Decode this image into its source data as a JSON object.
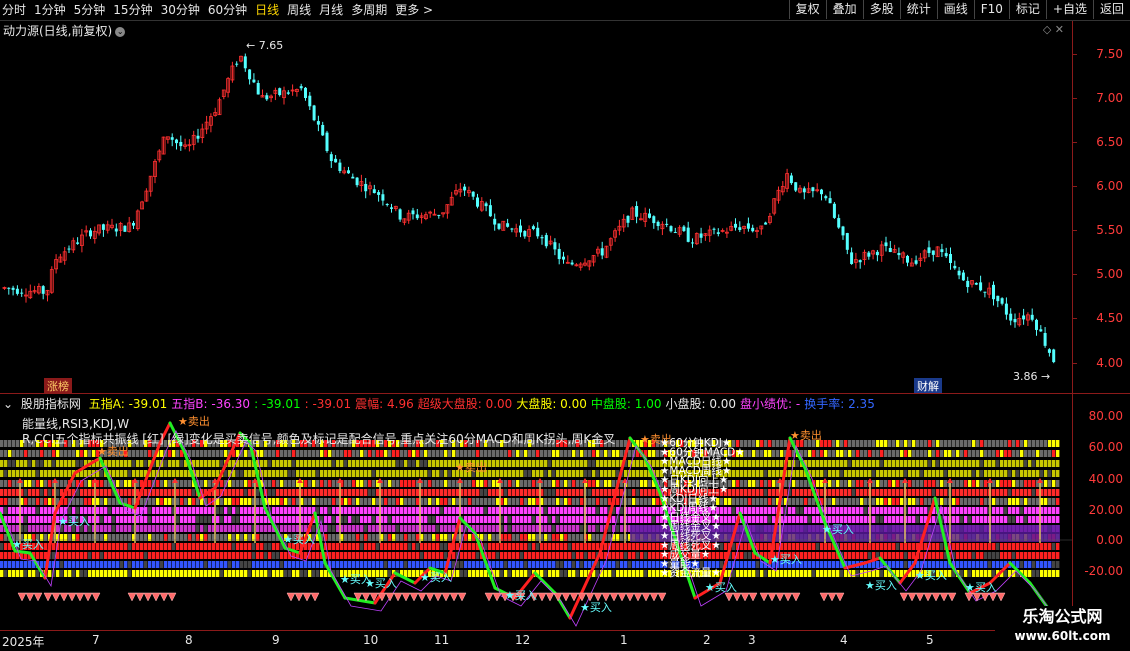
{
  "toolbar": {
    "periods": [
      "分时",
      "1分钟",
      "5分钟",
      "15分钟",
      "30分钟",
      "60分钟",
      "日线",
      "周线",
      "月线",
      "多周期",
      "更多 >"
    ],
    "active_period": "日线",
    "buttons": [
      "复权",
      "叠加",
      "多股",
      "统计",
      "画线",
      "F10",
      "标记",
      "+自选",
      "返回"
    ]
  },
  "main_panel": {
    "title": "动力源(日线,前复权)",
    "high_label": "7.65",
    "low_label": "3.86",
    "badge_left": "涨榜",
    "badge_right": "财解",
    "price_ticks": [
      "7.50",
      "7.00",
      "6.50",
      "6.00",
      "5.50",
      "5.00",
      "4.50",
      "4.00"
    ],
    "colors": {
      "up": "#ff3030",
      "down": "#54ffff"
    }
  },
  "indicator_panel": {
    "title": "股朋指标网",
    "values": [
      {
        "text": "五指A: -39.01",
        "color": "#ffff00"
      },
      {
        "text": "五指B: -36.30",
        "color": "#ff44ff"
      },
      {
        "text": ": -39.01",
        "color": "#00ff00"
      },
      {
        "text": ": -39.01",
        "color": "#ff3030"
      },
      {
        "text": "震幅: 4.96",
        "color": "#ff3030"
      },
      {
        "text": "超级大盘股: 0.00",
        "color": "#ff3030"
      },
      {
        "text": "大盘股: 0.00",
        "color": "#ffff00"
      },
      {
        "text": "中盘股: 1.00",
        "color": "#00ff00"
      },
      {
        "text": "小盘股: 0.00",
        "color": "#e8e8e8"
      },
      {
        "text": "盘小绩优: -",
        "color": "#ff44ff"
      },
      {
        "text": "换手率: 2.35",
        "color": "#3366ff"
      }
    ],
    "line1": "能量线,RSI3,KDJ,W",
    "line2": "R,CCI五个指标共振线 [红] [绿]变化是买卖信号,颜色及标记是配合信号,重点关注60分MACD和周K拐头,周K金叉",
    "ticks": [
      "80.00",
      "60.00",
      "40.00",
      "20.00",
      "0.00",
      "-20.00"
    ],
    "strip_labels": [
      "60分钟KDJ",
      "60分钟MACD",
      "MACD日线",
      "MACD周线",
      "日KDJ向上",
      "周KDJ向上",
      "KDJ日线",
      "KDJ周线",
      "日线金叉",
      "周线金叉",
      "日线死叉",
      "周线死叉",
      "成交量",
      "量能",
      "资金流量"
    ],
    "buy_label": "买入",
    "sell_label": "卖出"
  },
  "dates": [
    "2025年",
    "7",
    "8",
    "9",
    "10",
    "11",
    "12",
    "1",
    "2",
    "3",
    "4",
    "5"
  ],
  "watermark": {
    "line1": "乐淘公式网",
    "line2": "www.60lt.com"
  }
}
